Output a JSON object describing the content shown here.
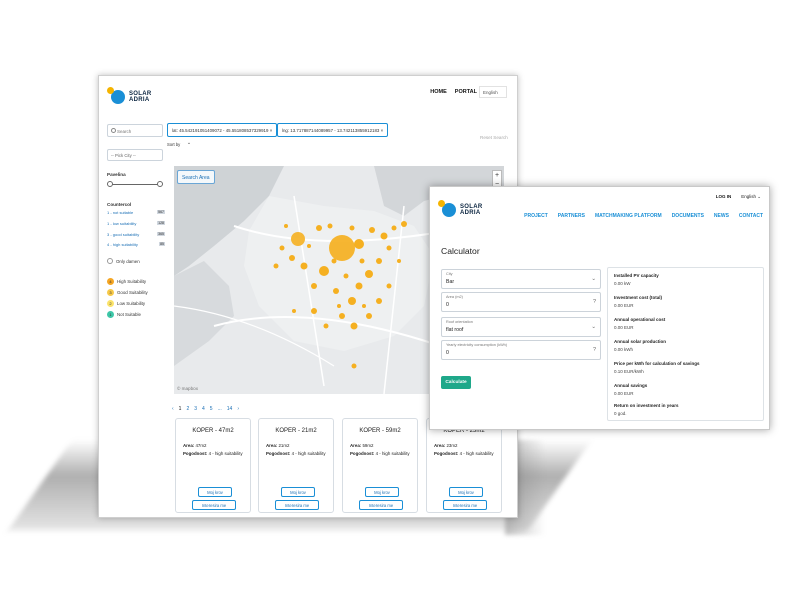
{
  "main": {
    "logo_line1": "SOLAR",
    "logo_line2": "ADRIA",
    "nav": [
      "HOME",
      "PORTAL"
    ],
    "language": "English",
    "search_placeholder": "Search",
    "pick_city": "-- Pick City --",
    "pavelina_label": "Pavelina",
    "countercol_label": "Countercol",
    "suitability_links": [
      {
        "label": "1 - not suitable",
        "count": "567"
      },
      {
        "label": "1 - low suitability",
        "count": "128"
      },
      {
        "label": "3 - good suitability",
        "count": "365"
      },
      {
        "label": "4 - high suitability",
        "count": "85"
      }
    ],
    "only_damen": "Only damen",
    "legend": [
      {
        "num": "4",
        "label": "High Suitability",
        "color": "#f5a623"
      },
      {
        "num": "3",
        "label": "Good Suitability",
        "color": "#f7c948"
      },
      {
        "num": "2",
        "label": "Low Suitability",
        "color": "#fbe36a"
      },
      {
        "num": "1",
        "label": "Not Suitable",
        "color": "#3ec7a8"
      }
    ],
    "filter_lat": "lat: 45.542191051409072 - 45.551808537329919",
    "filter_lng": "lng: 13.717887144089957 - 13.742113855912183",
    "reset_search": "Reset Search",
    "sort_by": "Sort by",
    "search_area": "Search Area",
    "zoom_plus": "+",
    "zoom_minus": "−",
    "mapbox": "© mapbox",
    "pager": [
      "‹",
      "1",
      "2",
      "3",
      "4",
      "5",
      "...",
      "14",
      "›"
    ],
    "cards": [
      {
        "title": "KOPER - 47m2",
        "area_label": "Area:",
        "area": "47m2",
        "pog_label": "Pogodnost:",
        "pog": "4 - high suitability",
        "btn1": "Moj krov",
        "btn2": "Interesira me"
      },
      {
        "title": "KOPER - 21m2",
        "area_label": "Area:",
        "area": "21m2",
        "pog_label": "Pogodnost:",
        "pog": "4 - high suitability",
        "btn1": "Moj krov",
        "btn2": "Interesira me"
      },
      {
        "title": "KOPER - 59m2",
        "area_label": "Area:",
        "area": "59m2",
        "pog_label": "Pogodnost:",
        "pog": "4 - high suitability",
        "btn1": "Moj krov",
        "btn2": "Interesira me"
      },
      {
        "title": "KOPER - 23m2",
        "area_label": "Area:",
        "area": "23m2",
        "pog_label": "Pogodnost:",
        "pog": "4 - high suitability",
        "btn1": "Moj krov",
        "btn2": "Interesira me"
      }
    ]
  },
  "calc": {
    "logo_line1": "SOLAR",
    "logo_line2": "ADRIA",
    "login": "LOG IN",
    "language": "English ⌄",
    "nav": [
      "PROJECT",
      "PARTNERS",
      "MATCHMAKING PLATFORM",
      "DOCUMENTS",
      "NEWS",
      "CONTACT"
    ],
    "title": "Calculator",
    "fields": [
      {
        "label": "City",
        "value": "Bar",
        "suffix": "⌄"
      },
      {
        "label": "Area (m2)",
        "value": "0",
        "suffix": "?"
      },
      {
        "label": "Roof orientation",
        "value": "flat roof",
        "suffix": "⌄"
      },
      {
        "label": "Yearly electricity consumption (kWh)",
        "value": "0",
        "suffix": "?"
      }
    ],
    "calculate": "Calculate",
    "results": [
      {
        "label": "Installed PV capacity",
        "value": "0.00 kW"
      },
      {
        "label": "Investment cost (total)",
        "value": "0.00 EUR"
      },
      {
        "label": "Annual operational cost",
        "value": "0.00 EUR"
      },
      {
        "label": "Annual solar production",
        "value": "0.00 kWh"
      },
      {
        "label": "Price per kWh for calculation of savings",
        "value": "0.10 EUR/kWh"
      },
      {
        "label": "Annual savings",
        "value": "0.00 EUR"
      },
      {
        "label": "Return on investment in years",
        "value": "0 god."
      }
    ]
  }
}
